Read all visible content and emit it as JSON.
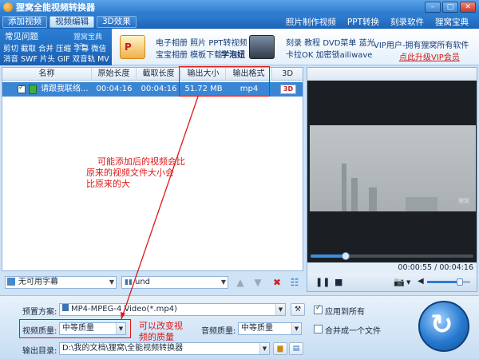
{
  "window": {
    "title": "狸窝全能视频转换器"
  },
  "tabs": [
    {
      "label": "添加视频",
      "active": false
    },
    {
      "label": "视频编辑",
      "active": true
    },
    {
      "label": "3D效果",
      "active": false
    }
  ],
  "top_links": [
    "照片制作视频",
    "PPT转换",
    "刻录软件",
    "狸窝宝典"
  ],
  "faq": {
    "title": "常见问题",
    "more": "狸窝宝典>>",
    "lines": [
      "剪切 截取 合并 压缩 字幕 微信",
      "消音 SWF 片头 GIF 双音轨 MV"
    ]
  },
  "promo": {
    "col1": [
      "电子相册 照片 PPT转视频",
      "宝宝相册 模板下载"
    ],
    "col1_bold": "学泡妞",
    "col2": [
      "刻录 教程 DVD菜单 蓝光",
      "卡拉OK 加密锁ailiwave"
    ],
    "vip_line": "VIP用户-拥有狸窝所有软件",
    "vip_link": "点此升级VIP会员"
  },
  "file_table": {
    "columns": [
      "名称",
      "原始长度",
      "截取长度",
      "输出大小",
      "输出格式",
      "3D"
    ],
    "rows": [
      {
        "name": "请跟我联络...",
        "original_length": "00:04:16",
        "clip_length": "00:04:16",
        "output_size": "51.72 MB",
        "output_format": "mp4",
        "badge_3d": "3D"
      }
    ]
  },
  "list_toolbar": {
    "subtitle": "无可用字幕",
    "audio": "und"
  },
  "player": {
    "time": "00:00:55 / 00:04:16",
    "progress": 0.215,
    "volume": 0.75,
    "video_watermark": "狸窝"
  },
  "settings": {
    "preset_label": "预置方案:",
    "preset_value": "MP4-MPEG-4 Video(*.mp4)",
    "apply_all": "应用到所有",
    "video_quality_label": "视频质量:",
    "video_quality_value": "中等质量",
    "audio_quality_label": "音频质量:",
    "audio_quality_value": "中等质量",
    "merge": "合并成一个文件",
    "output_dir_label": "输出目录:",
    "output_dir_value": "D:\\我的文档\\狸窝\\全能视频转换器"
  },
  "annotations": {
    "size_note": [
      "可能添加后的视频会比",
      "原来的视频文件大小会",
      "比原来的大"
    ],
    "quality_note": [
      "可以改变视",
      "频的质量"
    ]
  },
  "colors": {
    "titlebar": "#2a78cc",
    "selected_row": "#3b86d4",
    "annotation": "#e01616",
    "vip_link": "#d01818"
  }
}
